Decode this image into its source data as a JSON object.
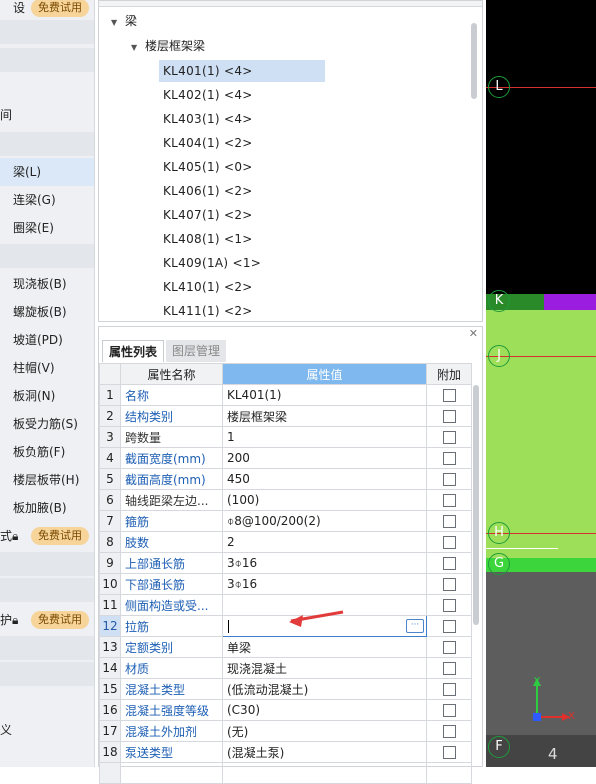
{
  "left_panel": {
    "top_partial": "设",
    "trial_badge": "免费试用",
    "row_partial_1": "间",
    "items": [
      {
        "label": "梁(L)"
      },
      {
        "label": "连梁(G)"
      },
      {
        "label": "圈梁(E)"
      },
      {
        "label": "现浇板(B)"
      },
      {
        "label": "螺旋板(B)"
      },
      {
        "label": "坡道(PD)"
      },
      {
        "label": "柱帽(V)"
      },
      {
        "label": "板洞(N)"
      },
      {
        "label": "板受力筋(S)"
      },
      {
        "label": "板负筋(F)"
      },
      {
        "label": "楼层板带(H)"
      },
      {
        "label": "板加腋(B)"
      }
    ],
    "lock_row_1": "式",
    "lock_row_2": "护",
    "row_partial_2": "义"
  },
  "tree": {
    "root_label": "梁",
    "group_label": "楼层框架梁",
    "items": [
      "KL401(1) <4>",
      "KL402(1) <4>",
      "KL403(1) <4>",
      "KL404(1) <2>",
      "KL405(1) <0>",
      "KL406(1) <2>",
      "KL407(1) <2>",
      "KL408(1) <1>",
      "KL409(1A) <1>",
      "KL410(1) <2>",
      "KL411(1) <2>"
    ]
  },
  "props": {
    "tabs": [
      "属性列表",
      "图层管理"
    ],
    "headers": {
      "name": "属性名称",
      "value": "属性值",
      "extra": "附加"
    },
    "rows": [
      {
        "n": "1",
        "name": "名称",
        "value": "KL401(1)"
      },
      {
        "n": "2",
        "name": "结构类别",
        "value": "楼层框架梁"
      },
      {
        "n": "3",
        "name": "跨数量",
        "value": "1"
      },
      {
        "n": "4",
        "name": "截面宽度(mm)",
        "value": "200"
      },
      {
        "n": "5",
        "name": "截面高度(mm)",
        "value": "450"
      },
      {
        "n": "6",
        "name": "轴线距梁左边...",
        "value": "(100)"
      },
      {
        "n": "7",
        "name": "箍筋",
        "value": "⌽8@100/200(2)"
      },
      {
        "n": "8",
        "name": "肢数",
        "value": "2"
      },
      {
        "n": "9",
        "name": "上部通长筋",
        "value": "3⌽16"
      },
      {
        "n": "10",
        "name": "下部通长筋",
        "value": "3⌽16"
      },
      {
        "n": "11",
        "name": "侧面构造或受...",
        "value": ""
      },
      {
        "n": "12",
        "name": "拉筋",
        "value": ""
      },
      {
        "n": "13",
        "name": "定额类别",
        "value": "单梁"
      },
      {
        "n": "14",
        "name": "材质",
        "value": "现浇混凝土"
      },
      {
        "n": "15",
        "name": "混凝土类型",
        "value": "(低流动混凝土)"
      },
      {
        "n": "16",
        "name": "混凝土强度等级",
        "value": "(C30)"
      },
      {
        "n": "17",
        "name": "混凝土外加剂",
        "value": "(无)"
      },
      {
        "n": "18",
        "name": "泵送类型",
        "value": "(混凝土泵)"
      }
    ],
    "ellipsis": "···"
  },
  "cad": {
    "axes": [
      "L",
      "K",
      "J",
      "H",
      "G",
      "F"
    ],
    "bottom_number": "4",
    "coord_x": "X",
    "coord_y": "Y"
  }
}
